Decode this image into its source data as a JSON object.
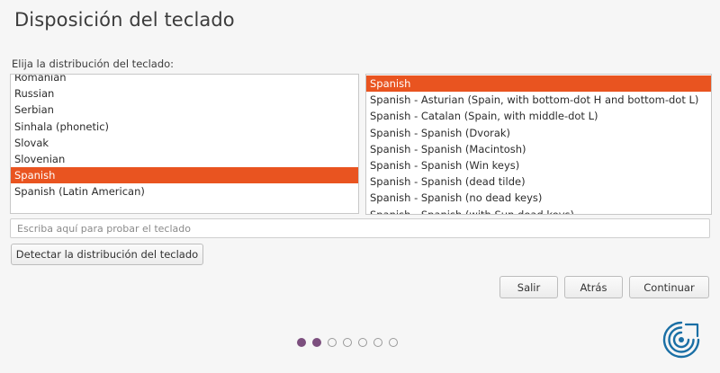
{
  "header": {
    "title": "Disposición del teclado",
    "prompt": "Elija la distribución del teclado:"
  },
  "layouts": {
    "items": [
      "Romanian",
      "Russian",
      "Serbian",
      "Sinhala (phonetic)",
      "Slovak",
      "Slovenian",
      "Spanish",
      "Spanish (Latin American)"
    ],
    "selected": "Spanish"
  },
  "variants": {
    "items": [
      "Spanish",
      "Spanish - Asturian (Spain, with bottom-dot H and bottom-dot L)",
      "Spanish - Catalan (Spain, with middle-dot L)",
      "Spanish - Spanish (Dvorak)",
      "Spanish - Spanish (Macintosh)",
      "Spanish - Spanish (Win keys)",
      "Spanish - Spanish (dead tilde)",
      "Spanish - Spanish (no dead keys)",
      "Spanish - Spanish (with Sun dead keys)"
    ],
    "selected": "Spanish"
  },
  "test_field": {
    "value": "",
    "placeholder": "Escriba aquí para probar el teclado"
  },
  "buttons": {
    "detect": "Detectar la distribución del teclado",
    "quit": "Salir",
    "back": "Atrás",
    "continue": "Continuar"
  },
  "progress": {
    "total_steps": 7,
    "completed_steps": 2
  },
  "colors": {
    "selection": "#e95420",
    "progress_dot": "#7c4f7e",
    "logo": "#1a6fa5"
  }
}
